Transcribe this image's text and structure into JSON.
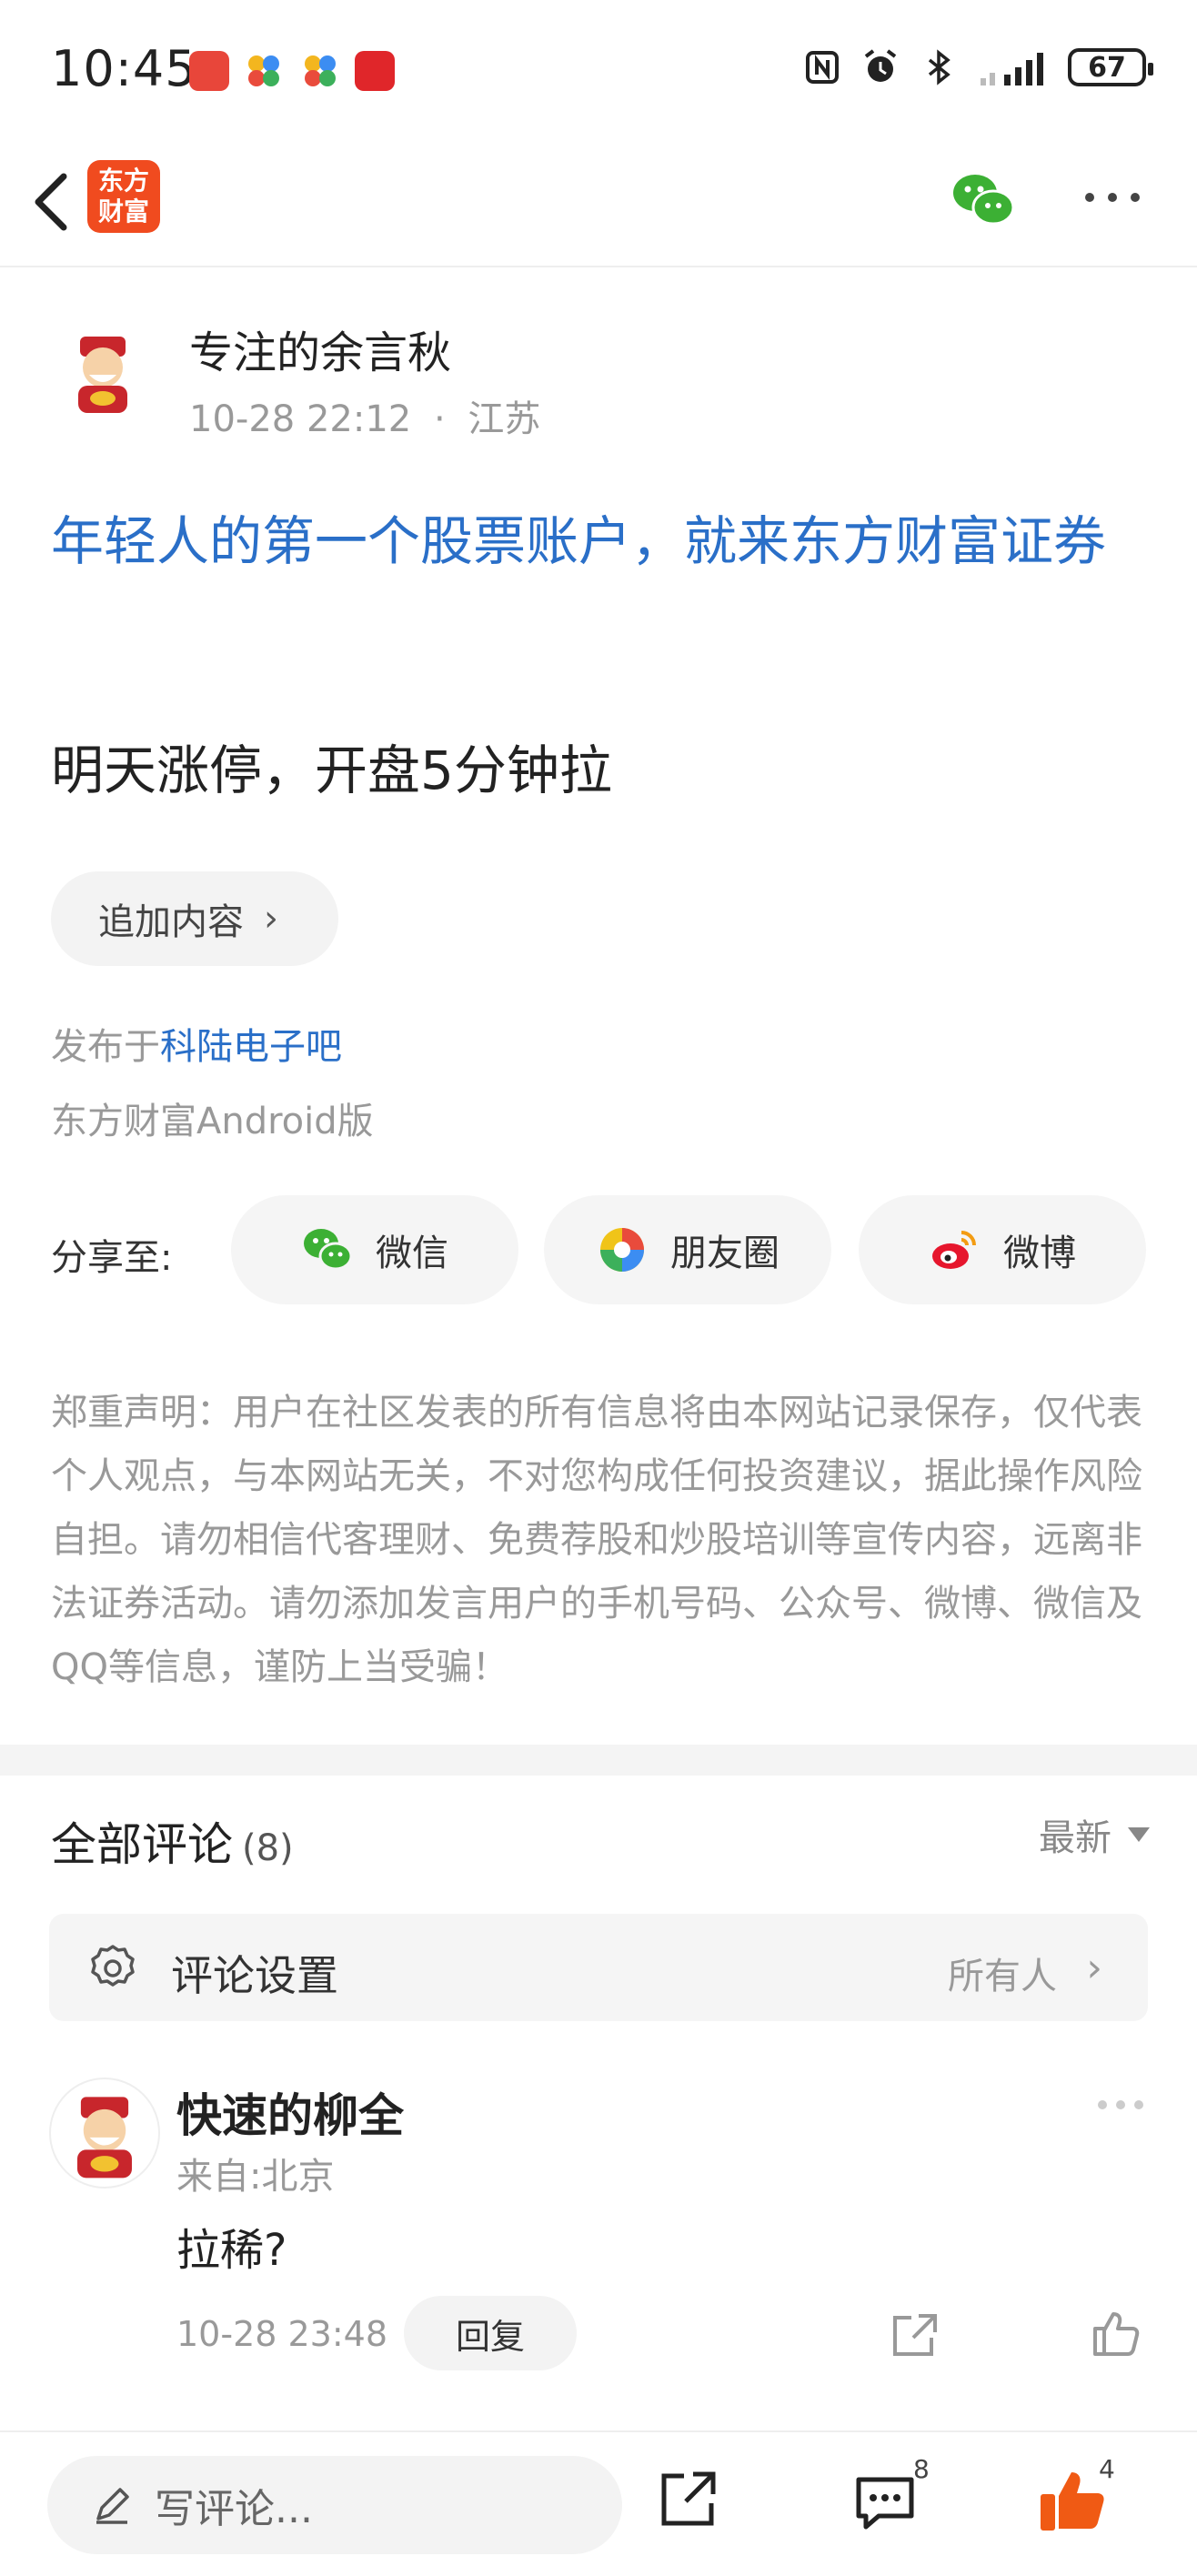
{
  "status_bar": {
    "time": "10:45",
    "battery": "67",
    "app_icons": [
      "huawei-store-icon",
      "app-icon",
      "app-icon",
      "app-icon"
    ]
  },
  "nav": {
    "logo_text_line1": "东方",
    "logo_text_line2": "财富",
    "accent": "#f04b1f"
  },
  "post": {
    "author": "专注的余言秋",
    "time": "10-28 22:12",
    "separator": "·",
    "location": "江苏",
    "title": "年轻人的第一个股票账户，就来东方财富证券",
    "body": "明天涨停，开盘5分钟拉",
    "append_label": "追加内容",
    "published_prefix": "发布于",
    "forum": "科陆电子吧",
    "client": "东方财富Android版"
  },
  "share": {
    "label": "分享至:",
    "wechat": "微信",
    "moments": "朋友圈",
    "weibo": "微博"
  },
  "disclaimer": "郑重声明：用户在社区发表的所有信息将由本网站记录保存，仅代表个人观点，与本网站无关，不对您构成任何投资建议，据此操作风险自担。请勿相信代客理财、免费荐股和炒股培训等宣传内容，远离非法证券活动。请勿添加发言用户的手机号码、公众号、微博、微信及QQ等信息，谨防上当受骗！",
  "comments": {
    "title": "全部评论",
    "count": "(8)",
    "sort": "最新",
    "settings_label": "评论设置",
    "settings_value": "所有人",
    "items": [
      {
        "name": "快速的柳全",
        "from": "来自:北京",
        "text": "拉稀?",
        "time": "10-28 23:48",
        "reply_label": "回复"
      }
    ]
  },
  "bottom_bar": {
    "placeholder": "写评论...",
    "comment_count": "8",
    "like_count": "4"
  },
  "colors": {
    "link_blue": "#2a6fc8",
    "brand_orange": "#f04b1f",
    "wechat_green": "#3cb034"
  }
}
